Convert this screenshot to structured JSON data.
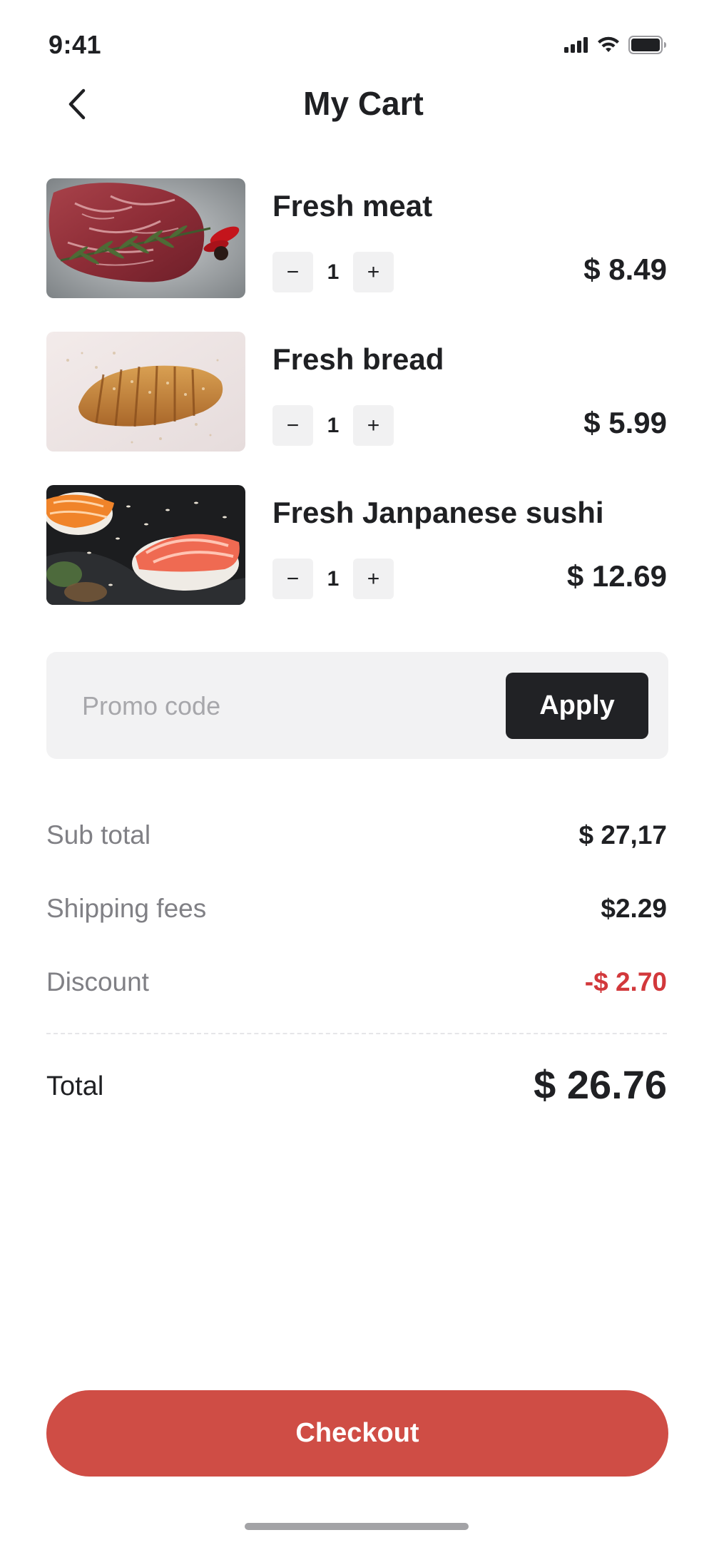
{
  "status_bar": {
    "time": "9:41",
    "icons": [
      "cellular-signal-icon",
      "wifi-icon",
      "battery-icon"
    ]
  },
  "header": {
    "title": "My Cart",
    "back_icon": "chevron-left-icon"
  },
  "cart": {
    "items": [
      {
        "name": "Fresh meat",
        "quantity": "1",
        "price": "$ 8.49",
        "image": "steak-with-rosemary-photo",
        "decrement": "−",
        "increment": "+"
      },
      {
        "name": "Fresh bread",
        "quantity": "1",
        "price": "$ 5.99",
        "image": "sliced-bread-loaf-photo",
        "decrement": "−",
        "increment": "+"
      },
      {
        "name": "Fresh Janpanese sushi",
        "quantity": "1",
        "price": "$ 12.69",
        "image": "salmon-sushi-photo",
        "decrement": "−",
        "increment": "+"
      }
    ]
  },
  "promo": {
    "placeholder": "Promo code",
    "value": "",
    "apply_label": "Apply"
  },
  "summary": {
    "subtotal_label": "Sub total",
    "subtotal_value": "$ 27,17",
    "shipping_label": "Shipping fees",
    "shipping_value": "$2.29",
    "discount_label": "Discount",
    "discount_value": "-$ 2.70",
    "total_label": "Total",
    "total_value": "$ 26.76"
  },
  "checkout": {
    "label": "Checkout"
  },
  "colors": {
    "accent": "#cf4d45",
    "discount": "#d2383b",
    "dark_button": "#212225",
    "muted_text": "#808085",
    "promo_bg": "#f2f2f3"
  }
}
